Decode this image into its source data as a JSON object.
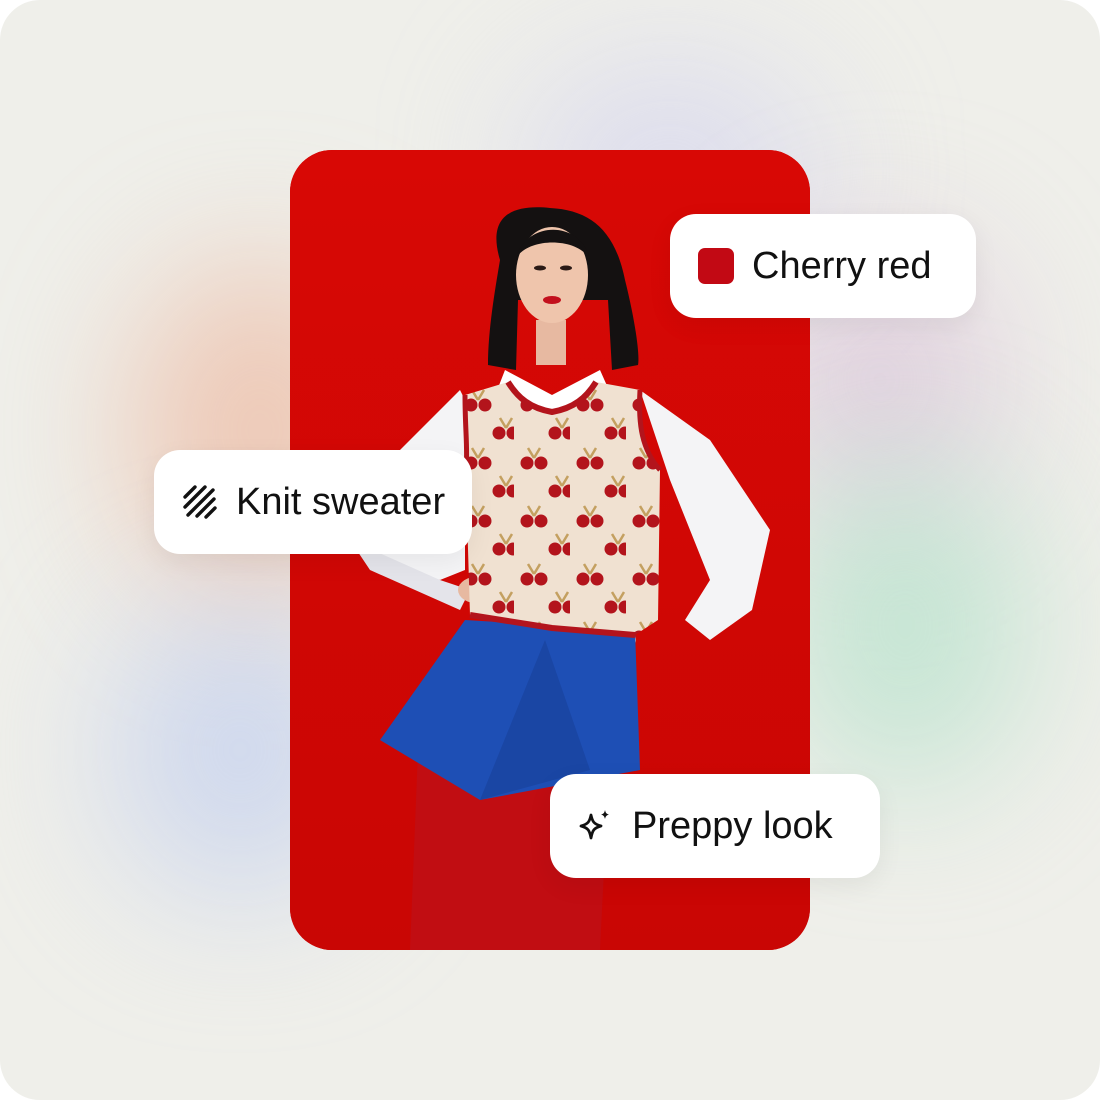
{
  "tags": [
    {
      "label": "Cherry red",
      "icon": "color-swatch-icon",
      "swatch_color": "#c20914"
    },
    {
      "label": "Knit sweater",
      "icon": "knit-texture-icon"
    },
    {
      "label": "Preppy look",
      "icon": "sparkle-icon"
    }
  ],
  "colors": {
    "background": "#efefea",
    "photo_background": "#d10604",
    "chip_background": "#ffffff",
    "text": "#111111"
  }
}
